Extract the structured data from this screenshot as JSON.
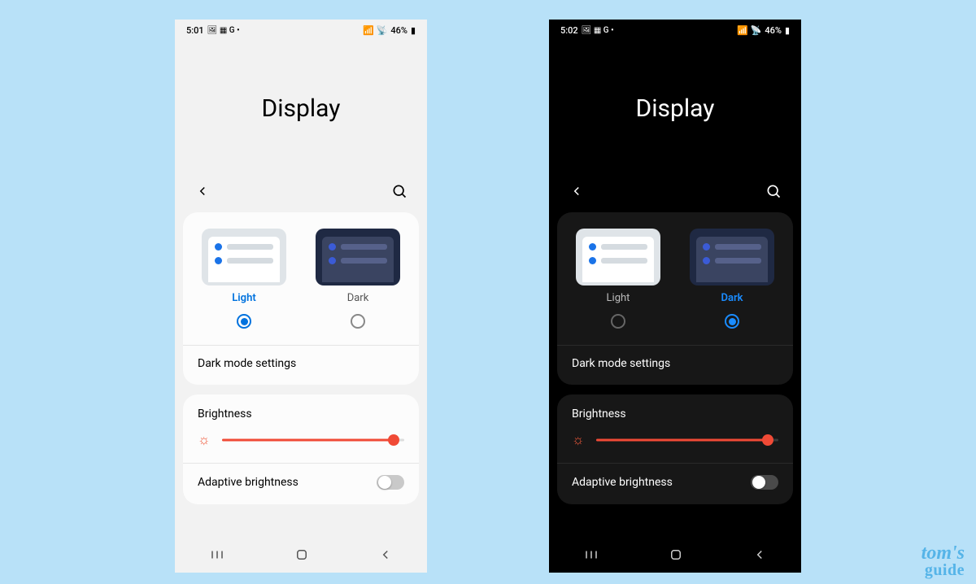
{
  "page_bg": "#b8e1f8",
  "watermark": {
    "line1": "tom's",
    "line2": "guide"
  },
  "phones": [
    {
      "theme": "light",
      "status": {
        "time": "5:01",
        "icons_left": "🖼 ▦ G •",
        "icons_right": "📶 📡",
        "battery": "46%"
      },
      "title": "Display",
      "theme_chooser": {
        "options": [
          {
            "label": "Light",
            "active": true
          },
          {
            "label": "Dark",
            "active": false
          }
        ],
        "settings_link": "Dark mode settings"
      },
      "brightness": {
        "label": "Brightness",
        "value_pct": 94,
        "adaptive_label": "Adaptive brightness",
        "adaptive_on": false
      }
    },
    {
      "theme": "dark",
      "status": {
        "time": "5:02",
        "icons_left": "🖼 ▦ G •",
        "icons_right": "📶 📡",
        "battery": "46%"
      },
      "title": "Display",
      "theme_chooser": {
        "options": [
          {
            "label": "Light",
            "active": false
          },
          {
            "label": "Dark",
            "active": true
          }
        ],
        "settings_link": "Dark mode settings"
      },
      "brightness": {
        "label": "Brightness",
        "value_pct": 94,
        "adaptive_label": "Adaptive brightness",
        "adaptive_on": false
      }
    }
  ]
}
